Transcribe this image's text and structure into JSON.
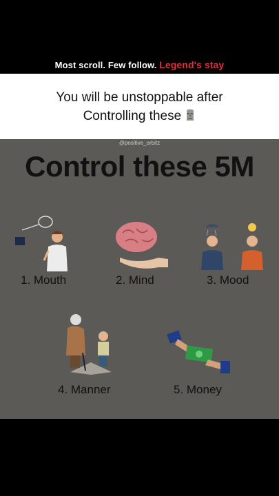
{
  "banner": {
    "tagline_plain": "Most scroll. Few follow.",
    "tagline_accent": "Legend's stay",
    "headline_line1": "You will be unstoppable after",
    "headline_line2": "Controlling these"
  },
  "poster": {
    "watermark": "@positive_orbitz",
    "title": "Control these 5M",
    "items": [
      {
        "label": "1. Mouth",
        "icon": "speaking-man-icon"
      },
      {
        "label": "2. Mind",
        "icon": "brain-in-hand-icon"
      },
      {
        "label": "3. Mood",
        "icon": "mood-people-icon"
      },
      {
        "label": "4. Manner",
        "icon": "helping-elder-icon"
      },
      {
        "label": "5. Money",
        "icon": "money-hands-icon"
      }
    ]
  },
  "colors": {
    "accent": "#e0313a",
    "poster_bg": "#5c5a56",
    "band_bg": "#ffffff"
  }
}
